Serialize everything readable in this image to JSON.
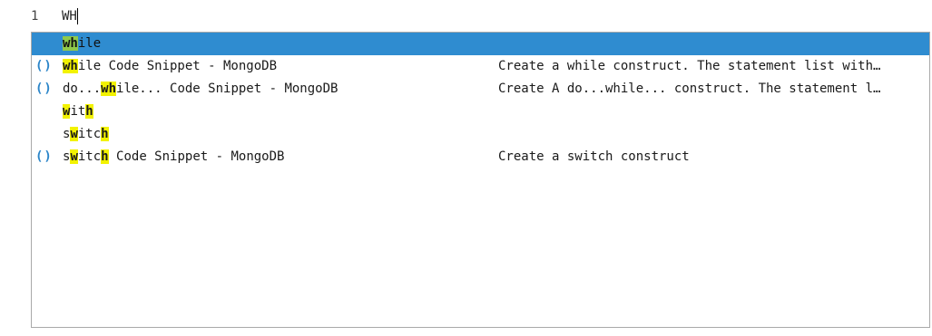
{
  "editor": {
    "line_number": "1",
    "line_text": "WH"
  },
  "suggestions": [
    {
      "icon": "",
      "pre": "",
      "match": "wh",
      "post": "ile",
      "description": "",
      "selected": true
    },
    {
      "icon": "()",
      "pre": "",
      "match": "wh",
      "post": "ile Code Snippet - MongoDB",
      "description": "Create a while construct. The statement list with…",
      "selected": false
    },
    {
      "icon": "()",
      "pre": "do...",
      "match": "wh",
      "post": "ile... Code Snippet - MongoDB",
      "description": "Create A do...while... construct. The statement l…",
      "selected": false
    },
    {
      "icon": "",
      "pre": "",
      "match": "w",
      "mid": "it",
      "match2": "h",
      "post": "",
      "description": "",
      "selected": false
    },
    {
      "icon": "",
      "pre": "s",
      "match": "w",
      "mid": "itc",
      "match2": "h",
      "post": "",
      "description": "",
      "selected": false
    },
    {
      "icon": "()",
      "pre": "s",
      "match": "w",
      "mid": "itc",
      "match2": "h",
      "post": " Code Snippet - MongoDB",
      "description": "Create a switch construct",
      "selected": false
    }
  ],
  "colors": {
    "selection": "#2f8cd0",
    "match_highlight": "#f2f200",
    "selected_match_highlight": "#8fc94a",
    "snippet_icon": "#2d86c9"
  }
}
